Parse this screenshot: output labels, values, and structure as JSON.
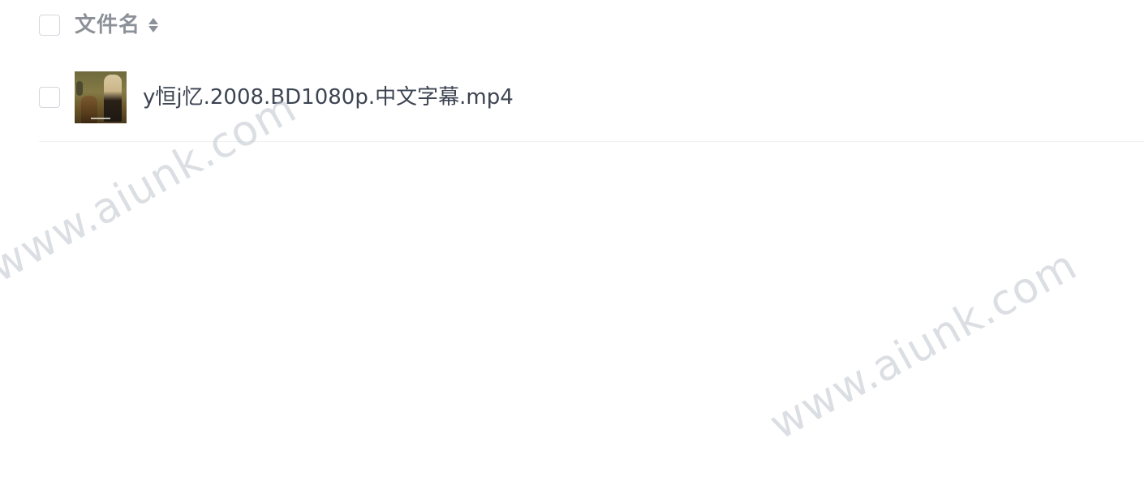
{
  "file_list": {
    "header": {
      "column_label": "文件名"
    },
    "files": [
      {
        "name": "y恒j忆.2008.BD1080p.中文字幕.mp4"
      }
    ]
  },
  "watermarks": [
    "www.aiunk.com",
    "www.aiunk.com"
  ],
  "colors": {
    "border": "#d3d6dc",
    "header_text": "#8c9199",
    "file_text": "#3d4452",
    "divider": "#eef0f3"
  }
}
